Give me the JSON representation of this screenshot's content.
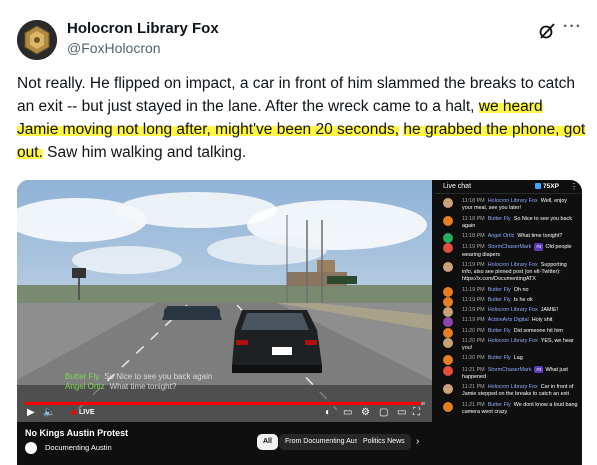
{
  "tweet": {
    "author_name": "Holocron Library Fox",
    "author_handle": "@FoxHolocron",
    "text_plain": "Not really. He flipped on impact, a car in front of him slammed the breaks to catch an exit -- but just stayed in the lane. After the wreck came to a halt, ",
    "text_highlighted_1": "we heard Jamie moving not long after, might've been 20 seconds,",
    "text_highlighted_2": "he grabbed the phone, got out.",
    "text_tail": " Saw him walking and talking.",
    "highlight_color": "#fff544"
  },
  "video": {
    "title": "No Kings Austin Protest",
    "channel": "Documenting Austin",
    "live_label": "LIVE",
    "progress_fraction": 0.99,
    "overlay_chat": [
      {
        "user": "Butter Fly",
        "message": "So Nice to see you back again"
      },
      {
        "user": "Angel Ortiz",
        "message": "What time tonight?"
      }
    ],
    "chips": [
      "All",
      "From Documenting Austin",
      "Politics News"
    ]
  },
  "chat": {
    "title": "Live chat",
    "viewer_count": "75XP",
    "messages": [
      {
        "time": "11:18 PM",
        "author": "Holocron Library Fox",
        "text": "Well, enjoy your meal, see you later!",
        "color": "#c9a27a"
      },
      {
        "time": "11:18 PM",
        "author": "Butter Fly",
        "text": "So Nice to see you back again",
        "color": "#e67e22"
      },
      {
        "time": "11:18 PM",
        "author": "Angel Ortiz",
        "text": "What time tonight?",
        "color": "#27ae60"
      },
      {
        "time": "11:19 PM",
        "author": "StormChaserMark",
        "badge": "#3",
        "text": "Old people wearing diapers",
        "color": "#e74c3c"
      },
      {
        "time": "11:19 PM",
        "author": "Holocron Library Fox",
        "text": "Supporting info, also see pinned post (on elt-Twitter): https://x.com/DocumentingATX",
        "color": "#c9a27a"
      },
      {
        "time": "11:19 PM",
        "author": "Butter Fly",
        "text": "Oh no",
        "color": "#e67e22"
      },
      {
        "time": "11:19 PM",
        "author": "Butter Fly",
        "text": "Is he ok",
        "color": "#e67e22"
      },
      {
        "time": "11:19 PM",
        "author": "Holocron Library Fox",
        "text": "JAMIE!",
        "color": "#c9a27a"
      },
      {
        "time": "11:19 PM",
        "author": "ActionArts Digital",
        "text": "Holy shit",
        "color": "#8e44ad"
      },
      {
        "time": "11:20 PM",
        "author": "Butter Fly",
        "text": "Did someone hit him",
        "color": "#e67e22"
      },
      {
        "time": "11:20 PM",
        "author": "Holocron Library Fox",
        "text": "YES, we hear you!",
        "color": "#c9a27a"
      },
      {
        "time": "11:20 PM",
        "author": "Butter Fly",
        "text": "Lag",
        "color": "#e67e22"
      },
      {
        "time": "11:21 PM",
        "author": "StormChaserMark",
        "badge": "#3",
        "text": "What just happened",
        "color": "#e74c3c"
      },
      {
        "time": "11:21 PM",
        "author": "Holocron Library Fox",
        "text": "Car in front of Jamie stepped on the breaks to catch an exit",
        "color": "#c9a27a"
      },
      {
        "time": "11:21 PM",
        "author": "Butter Fly",
        "text": "We dont know a loud bang camera went crazy",
        "color": "#e67e22"
      }
    ]
  }
}
